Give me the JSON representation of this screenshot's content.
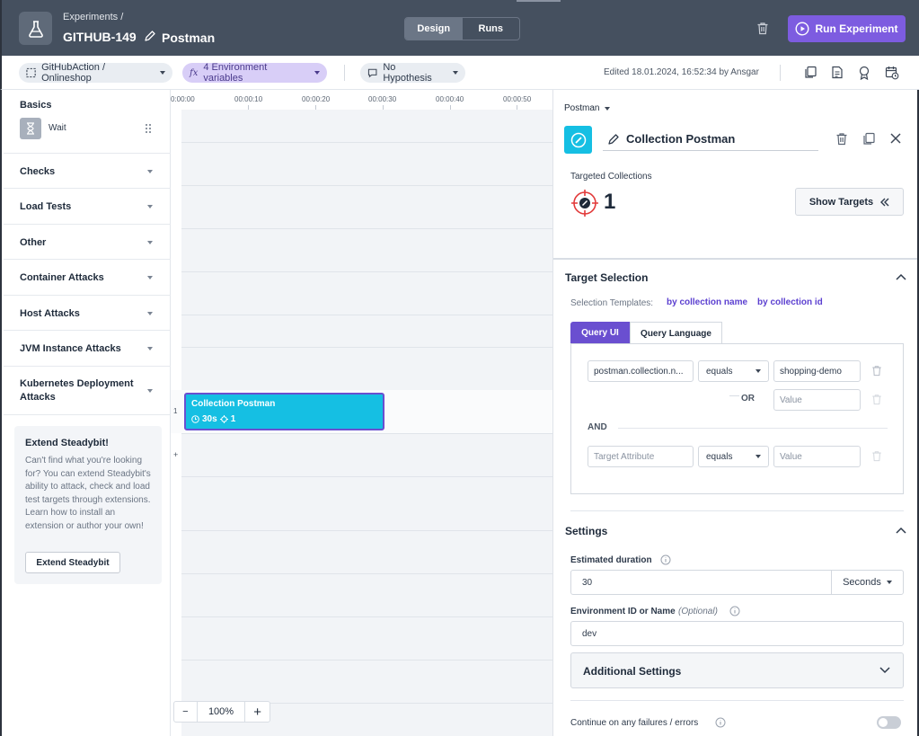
{
  "header": {
    "breadcrumb": "Experiments /",
    "experiment_key": "GITHUB-149",
    "experiment_name": "Postman",
    "tabs": [
      "Design",
      "Runs"
    ],
    "active_tab": "Design",
    "run_button": "Run Experiment"
  },
  "toolbar": {
    "environment": "GitHubAction / Onlineshop",
    "env_variables": "4 Environment variables",
    "hypothesis": "No Hypothesis",
    "edited": "Edited 18.01.2024, 16:52:34 by Ansgar"
  },
  "sidebar": {
    "basics_title": "Basics",
    "wait_label": "Wait",
    "sections": [
      "Checks",
      "Load Tests",
      "Other",
      "Container Attacks",
      "Host Attacks",
      "JVM Instance Attacks",
      "Kubernetes Deployment Attacks"
    ],
    "extend": {
      "title": "Extend Steadybit!",
      "text": "Can't find what you're looking for? You can extend Steadybit's ability to attack, check and load test targets through extensions. Learn how to install an extension or author your own!",
      "button": "Extend Steadybit"
    }
  },
  "canvas": {
    "ticks": [
      "0:00:00",
      "00:00:10",
      "00:00:20",
      "00:00:30",
      "00:00:40",
      "00:00:50"
    ],
    "lane_number": "1",
    "add_lane": "+",
    "step_name": "Collection Postman",
    "step_duration": "30s",
    "step_targets": "1",
    "zoom_minus": "−",
    "zoom_level": "100%",
    "zoom_plus": "+"
  },
  "panel": {
    "dropdown": "Postman",
    "step_title": "Collection Postman",
    "targeted_label": "Targeted Collections",
    "targeted_count": "1",
    "show_targets": "Show Targets",
    "target_selection_title": "Target Selection",
    "templates_label": "Selection Templates:",
    "template_1": "by collection name",
    "template_2": "by collection id",
    "query_tabs": [
      "Query UI",
      "Query Language"
    ],
    "active_query_tab": "Query UI",
    "query": {
      "row1_attribute": "postman.collection.n...",
      "row1_operator": "equals",
      "row1_value": "shopping-demo",
      "or_label": "OR",
      "value_placeholder": "Value",
      "and_label": "AND",
      "row2_attribute_placeholder": "Target Attribute",
      "row2_operator": "equals",
      "row2_value_placeholder": "Value"
    },
    "settings_title": "Settings",
    "estimated_duration_label": "Estimated duration",
    "estimated_duration_value": "30",
    "duration_unit": "Seconds",
    "env_id_label": "Environment ID or Name",
    "env_id_optional": "(Optional)",
    "env_id_value": "dev",
    "additional_settings": "Additional Settings",
    "continue_label": "Continue on any failures / errors",
    "continue_enabled": false
  },
  "colors": {
    "header_bg": "#45505f",
    "accent_purple": "#7d5ce0",
    "step_cyan": "#15bfe3",
    "link_purple": "#5b3fd0"
  }
}
